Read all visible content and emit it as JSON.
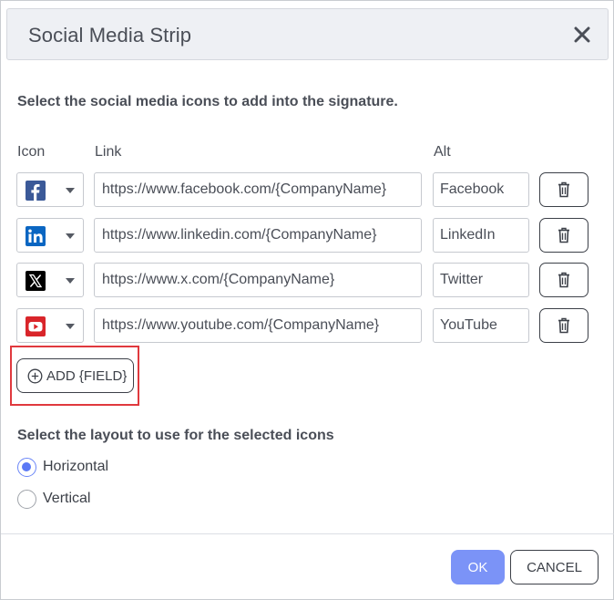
{
  "dialog": {
    "title": "Social Media Strip",
    "close_icon": "close-icon"
  },
  "instruction": "Select the social media icons to add into the signature.",
  "columns": {
    "icon": "Icon",
    "link": "Link",
    "alt": "Alt"
  },
  "rows": [
    {
      "icon": "facebook-icon",
      "color": "#3b5998",
      "link": "https://www.facebook.com/{CompanyName}",
      "alt": "Facebook"
    },
    {
      "icon": "linkedin-icon",
      "color": "#0a66c2",
      "link": "https://www.linkedin.com/{CompanyName}",
      "alt": "LinkedIn"
    },
    {
      "icon": "x-icon",
      "color": "#000000",
      "link": "https://www.x.com/{CompanyName}",
      "alt": "Twitter"
    },
    {
      "icon": "youtube-icon",
      "color": "#d9252a",
      "link": "https://www.youtube.com/{CompanyName}",
      "alt": "YouTube"
    }
  ],
  "add_field_label": "ADD {FIELD}",
  "layout": {
    "title": "Select the layout to use for the selected icons",
    "options": [
      {
        "label": "Horizontal",
        "checked": true
      },
      {
        "label": "Vertical",
        "checked": false
      }
    ]
  },
  "footer": {
    "ok_label": "OK",
    "cancel_label": "CANCEL"
  },
  "colors": {
    "accent": "#7b93f7",
    "highlight": "#e0393e"
  }
}
